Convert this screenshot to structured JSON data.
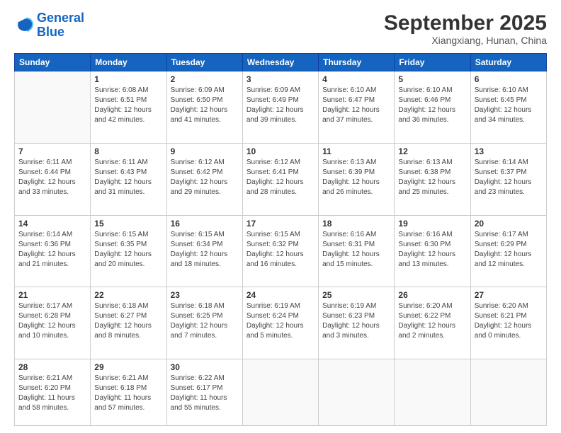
{
  "logo": {
    "line1": "General",
    "line2": "Blue"
  },
  "header": {
    "month": "September 2025",
    "location": "Xiangxiang, Hunan, China"
  },
  "weekdays": [
    "Sunday",
    "Monday",
    "Tuesday",
    "Wednesday",
    "Thursday",
    "Friday",
    "Saturday"
  ],
  "weeks": [
    [
      {
        "day": "",
        "info": ""
      },
      {
        "day": "1",
        "info": "Sunrise: 6:08 AM\nSunset: 6:51 PM\nDaylight: 12 hours\nand 42 minutes."
      },
      {
        "day": "2",
        "info": "Sunrise: 6:09 AM\nSunset: 6:50 PM\nDaylight: 12 hours\nand 41 minutes."
      },
      {
        "day": "3",
        "info": "Sunrise: 6:09 AM\nSunset: 6:49 PM\nDaylight: 12 hours\nand 39 minutes."
      },
      {
        "day": "4",
        "info": "Sunrise: 6:10 AM\nSunset: 6:47 PM\nDaylight: 12 hours\nand 37 minutes."
      },
      {
        "day": "5",
        "info": "Sunrise: 6:10 AM\nSunset: 6:46 PM\nDaylight: 12 hours\nand 36 minutes."
      },
      {
        "day": "6",
        "info": "Sunrise: 6:10 AM\nSunset: 6:45 PM\nDaylight: 12 hours\nand 34 minutes."
      }
    ],
    [
      {
        "day": "7",
        "info": "Sunrise: 6:11 AM\nSunset: 6:44 PM\nDaylight: 12 hours\nand 33 minutes."
      },
      {
        "day": "8",
        "info": "Sunrise: 6:11 AM\nSunset: 6:43 PM\nDaylight: 12 hours\nand 31 minutes."
      },
      {
        "day": "9",
        "info": "Sunrise: 6:12 AM\nSunset: 6:42 PM\nDaylight: 12 hours\nand 29 minutes."
      },
      {
        "day": "10",
        "info": "Sunrise: 6:12 AM\nSunset: 6:41 PM\nDaylight: 12 hours\nand 28 minutes."
      },
      {
        "day": "11",
        "info": "Sunrise: 6:13 AM\nSunset: 6:39 PM\nDaylight: 12 hours\nand 26 minutes."
      },
      {
        "day": "12",
        "info": "Sunrise: 6:13 AM\nSunset: 6:38 PM\nDaylight: 12 hours\nand 25 minutes."
      },
      {
        "day": "13",
        "info": "Sunrise: 6:14 AM\nSunset: 6:37 PM\nDaylight: 12 hours\nand 23 minutes."
      }
    ],
    [
      {
        "day": "14",
        "info": "Sunrise: 6:14 AM\nSunset: 6:36 PM\nDaylight: 12 hours\nand 21 minutes."
      },
      {
        "day": "15",
        "info": "Sunrise: 6:15 AM\nSunset: 6:35 PM\nDaylight: 12 hours\nand 20 minutes."
      },
      {
        "day": "16",
        "info": "Sunrise: 6:15 AM\nSunset: 6:34 PM\nDaylight: 12 hours\nand 18 minutes."
      },
      {
        "day": "17",
        "info": "Sunrise: 6:15 AM\nSunset: 6:32 PM\nDaylight: 12 hours\nand 16 minutes."
      },
      {
        "day": "18",
        "info": "Sunrise: 6:16 AM\nSunset: 6:31 PM\nDaylight: 12 hours\nand 15 minutes."
      },
      {
        "day": "19",
        "info": "Sunrise: 6:16 AM\nSunset: 6:30 PM\nDaylight: 12 hours\nand 13 minutes."
      },
      {
        "day": "20",
        "info": "Sunrise: 6:17 AM\nSunset: 6:29 PM\nDaylight: 12 hours\nand 12 minutes."
      }
    ],
    [
      {
        "day": "21",
        "info": "Sunrise: 6:17 AM\nSunset: 6:28 PM\nDaylight: 12 hours\nand 10 minutes."
      },
      {
        "day": "22",
        "info": "Sunrise: 6:18 AM\nSunset: 6:27 PM\nDaylight: 12 hours\nand 8 minutes."
      },
      {
        "day": "23",
        "info": "Sunrise: 6:18 AM\nSunset: 6:25 PM\nDaylight: 12 hours\nand 7 minutes."
      },
      {
        "day": "24",
        "info": "Sunrise: 6:19 AM\nSunset: 6:24 PM\nDaylight: 12 hours\nand 5 minutes."
      },
      {
        "day": "25",
        "info": "Sunrise: 6:19 AM\nSunset: 6:23 PM\nDaylight: 12 hours\nand 3 minutes."
      },
      {
        "day": "26",
        "info": "Sunrise: 6:20 AM\nSunset: 6:22 PM\nDaylight: 12 hours\nand 2 minutes."
      },
      {
        "day": "27",
        "info": "Sunrise: 6:20 AM\nSunset: 6:21 PM\nDaylight: 12 hours\nand 0 minutes."
      }
    ],
    [
      {
        "day": "28",
        "info": "Sunrise: 6:21 AM\nSunset: 6:20 PM\nDaylight: 11 hours\nand 58 minutes."
      },
      {
        "day": "29",
        "info": "Sunrise: 6:21 AM\nSunset: 6:18 PM\nDaylight: 11 hours\nand 57 minutes."
      },
      {
        "day": "30",
        "info": "Sunrise: 6:22 AM\nSunset: 6:17 PM\nDaylight: 11 hours\nand 55 minutes."
      },
      {
        "day": "",
        "info": ""
      },
      {
        "day": "",
        "info": ""
      },
      {
        "day": "",
        "info": ""
      },
      {
        "day": "",
        "info": ""
      }
    ]
  ]
}
